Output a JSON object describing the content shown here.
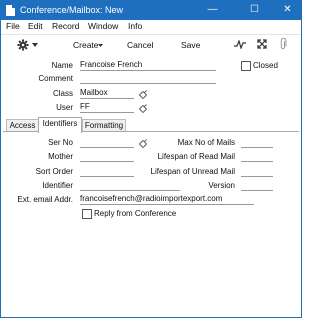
{
  "window": {
    "title": "Conference/Mailbox: New"
  },
  "titlebar_buttons": {
    "minimize": "—",
    "maximize": "☐",
    "close": "✕"
  },
  "menu": [
    "File",
    "Edit",
    "Record",
    "Window",
    "Info"
  ],
  "toolbar": {
    "actions_icon": "gear-icon",
    "create_label": "Create",
    "cancel_label": "Cancel",
    "save_label": "Save",
    "icons": [
      "activity-icon",
      "expand-icon",
      "paperclip-icon"
    ]
  },
  "header": {
    "name_label": "Name",
    "name_value": "Francoise French",
    "closed_label": "Closed",
    "closed_checked": false,
    "comment_label": "Comment",
    "comment_value": "",
    "class_label": "Class",
    "class_value": "Mailbox",
    "user_label": "User",
    "user_value": "FF"
  },
  "tabs": [
    {
      "label": "Access",
      "active": false
    },
    {
      "label": "Identifiers",
      "active": true
    },
    {
      "label": "Formatting",
      "active": false
    }
  ],
  "identifiers": {
    "ser_no_label": "Ser No",
    "ser_no_value": "",
    "mother_label": "Mother",
    "mother_value": "",
    "sort_order_label": "Sort Order",
    "sort_order_value": "",
    "identifier_label": "Identifier",
    "identifier_value": "",
    "max_mails_label": "Max No of Mails",
    "max_mails_value": "",
    "lifespan_read_label": "Lifespan of Read Mail",
    "lifespan_read_value": "",
    "lifespan_unread_label": "Lifespan of Unread Mail",
    "lifespan_unread_value": "",
    "version_label": "Version",
    "version_value": "",
    "ext_email_label": "Ext. email Addr.",
    "ext_email_value": "francoisefrench@radioimportexport.com",
    "reply_label": "Reply from Conference",
    "reply_checked": false
  }
}
